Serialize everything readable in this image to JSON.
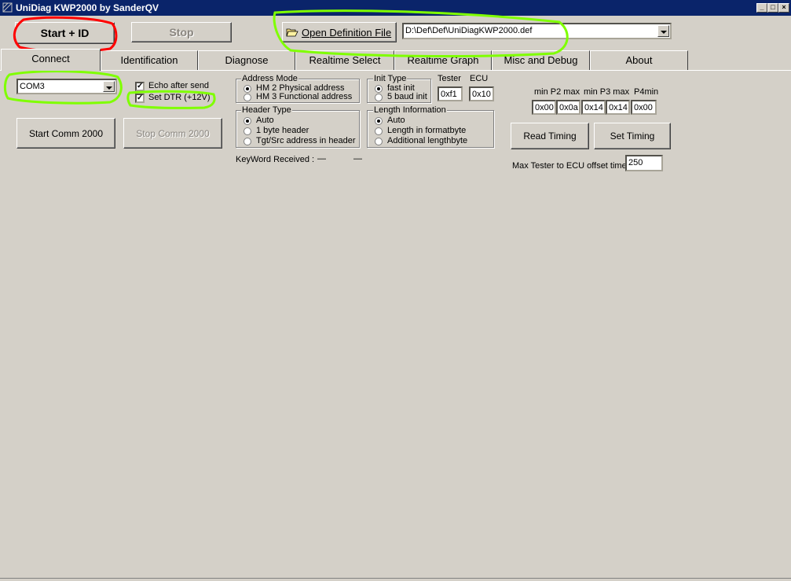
{
  "window": {
    "title": "UniDiag KWP2000 by SanderQV",
    "controls": [
      "minimize-icon",
      "maximize-icon",
      "close-icon"
    ]
  },
  "toolbar": {
    "start_id_label": "Start + ID",
    "stop_label": "Stop",
    "open_def_label": "Open Definition File",
    "def_path": "D:\\Def\\Def\\UniDiagKWP2000.def"
  },
  "tabs": [
    {
      "label": "Connect",
      "active": true
    },
    {
      "label": "Identification"
    },
    {
      "label": "Diagnose"
    },
    {
      "label": "Realtime Select"
    },
    {
      "label": "Realtime Graph"
    },
    {
      "label": "Misc and Debug"
    },
    {
      "label": "About"
    }
  ],
  "connect": {
    "com_port": "COM3",
    "echo_after_send": "Echo after send",
    "set_dtr": "Set DTR (+12V)",
    "start_comm": "Start Comm 2000",
    "stop_comm": "Stop  Comm 2000",
    "address_mode": {
      "title": "Address Mode",
      "options": [
        "HM 2 Physical address",
        "HM 3 Functional address"
      ]
    },
    "init_type": {
      "title": "Init Type",
      "options": [
        "fast init",
        "5 baud init"
      ]
    },
    "tester_label": "Tester",
    "tester_value": "0xf1",
    "ecu_label": "ECU",
    "ecu_value": "0x10",
    "header_type": {
      "title": "Header Type",
      "options": [
        "Auto",
        "1 byte  header",
        "Tgt/Src address in header"
      ]
    },
    "length_info": {
      "title": "Length Information",
      "options": [
        "Auto",
        "Length in formatbyte",
        "Additional lengthbyte"
      ]
    },
    "keyword_label": "KeyWord Received :",
    "keyword_value1": "—",
    "keyword_value2": "—"
  },
  "timing": {
    "labels": [
      "min P2 max",
      "min P3 max",
      "P4min"
    ],
    "values": [
      "0x00",
      "0x0a",
      "0x14",
      "0x14",
      "0x00"
    ],
    "read_timing": "Read Timing",
    "set_timing": "Set Timing",
    "offset_label": "Max Tester to ECU offset time",
    "offset_value": "250"
  },
  "colors": {
    "titlebar": "#0a246a",
    "annotation_red": "#ff0000",
    "annotation_green": "#7fff00"
  }
}
